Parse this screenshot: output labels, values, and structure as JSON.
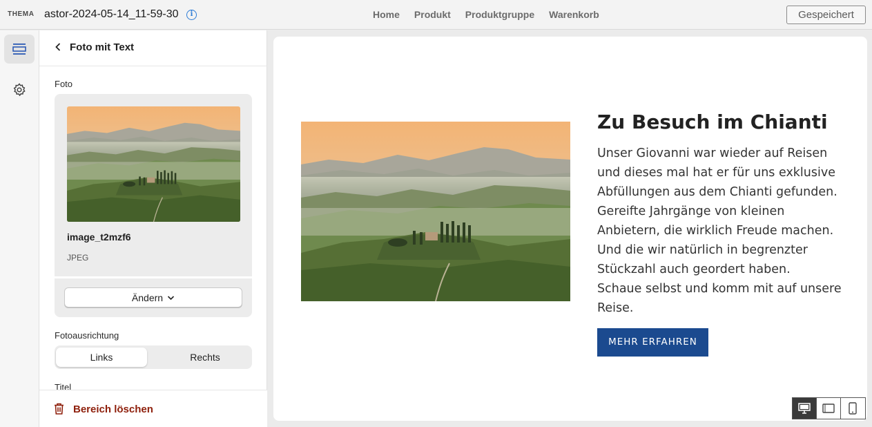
{
  "topbar": {
    "brand": "THEMA",
    "theme_name": "astor-2024-05-14_11-59-30",
    "nav": [
      "Home",
      "Produkt",
      "Produktgruppe",
      "Warenkorb"
    ],
    "saved_label": "Gespeichert"
  },
  "rail": {
    "items": [
      {
        "icon": "sections-icon",
        "active": true
      },
      {
        "icon": "gear-icon",
        "active": false
      }
    ]
  },
  "panel": {
    "title": "Foto mit Text",
    "photo_label": "Foto",
    "file_name": "image_t2mzf6",
    "file_type": "JPEG",
    "change_label": "Ändern",
    "alignment_label": "Fotoausrichtung",
    "alignment_options": [
      "Links",
      "Rechts"
    ],
    "alignment_selected": "Links",
    "title_label": "Titel",
    "delete_label": "Bereich löschen"
  },
  "preview": {
    "heading": "Zu Besuch im Chianti",
    "body_lines": [
      "Unser Giovanni war wieder auf Reisen",
      "und dieses mal hat er für uns exklusive",
      "Abfüllungen aus dem Chianti gefunden.",
      "Gereifte Jahrgänge von kleinen",
      "Anbietern, die wirklich Freude machen.",
      "Und die wir natürlich in begrenzter",
      "Stückzahl auch geordert haben.",
      "Schaue selbst und komm mit auf unsere",
      "Reise."
    ],
    "cta_label": "MEHR ERFAHREN",
    "cta_color": "#1b4a8f",
    "image_subject": "tuscany-landscape"
  },
  "devices": {
    "items": [
      "desktop-icon",
      "tablet-icon",
      "mobile-icon"
    ],
    "selected": "desktop-icon"
  },
  "colors": {
    "accent_blue": "#2b7bd6",
    "danger": "#8e1f0b"
  }
}
